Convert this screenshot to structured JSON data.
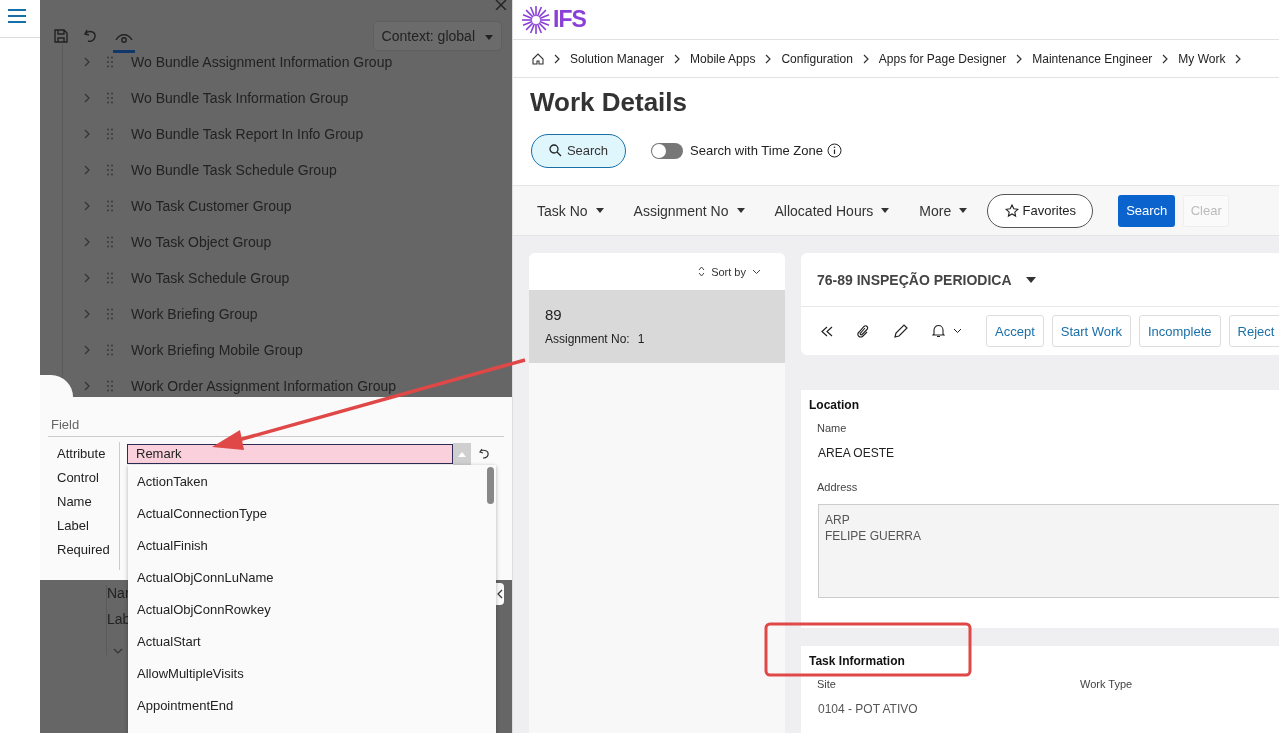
{
  "designer": {
    "context": "Context: global",
    "tree_items": [
      {
        "label": "Wo Bundle Assignment Information Group",
        "expanded": false
      },
      {
        "label": "Wo Bundle Task Information Group",
        "expanded": false
      },
      {
        "label": "Wo Bundle Task Report In Info Group",
        "expanded": false
      },
      {
        "label": "Wo Bundle Task Schedule Group",
        "expanded": false
      },
      {
        "label": "Wo Task Customer Group",
        "expanded": false
      },
      {
        "label": "Wo Task Object Group",
        "expanded": false
      },
      {
        "label": "Wo Task Schedule Group",
        "expanded": false
      },
      {
        "label": "Work Briefing Group",
        "expanded": false
      },
      {
        "label": "Work Briefing Mobile Group",
        "expanded": false
      },
      {
        "label": "Work Order Assignment Information Group",
        "expanded": false
      }
    ],
    "partial_labels": [
      "Nar",
      "Lab"
    ]
  },
  "field_panel": {
    "title": "Field",
    "labels": [
      "Attribute",
      "Control",
      "Name",
      "Label",
      "Required"
    ],
    "attribute": {
      "value": "Remark",
      "invalid": true
    },
    "options": [
      "ActionTaken",
      "ActualConnectionType",
      "ActualFinish",
      "ActualObjConnLuName",
      "ActualObjConnRowkey",
      "ActualStart",
      "AllowMultipleVisits",
      "AppointmentEnd"
    ]
  },
  "app": {
    "logo": "IFS",
    "breadcrumb": [
      "Solution Manager",
      "Mobile Apps",
      "Configuration",
      "Apps for Page Designer",
      "Maintenance Engineer",
      "My Work"
    ],
    "title": "Work Details",
    "search_button": "Search",
    "toggle": {
      "label": "Search with Time Zone",
      "on": false
    },
    "filters": [
      "Task No",
      "Assignment No",
      "Allocated Hours",
      "More"
    ],
    "favorites": "Favorites",
    "search": "Search",
    "clear": {
      "label": "Clear",
      "disabled": true
    }
  },
  "list": {
    "sort": "Sort by",
    "items": [
      {
        "title": "89",
        "label": "Assignment No:",
        "value": "1",
        "selected": true
      }
    ]
  },
  "detail": {
    "title": "76-89 INSPEÇÃO PERIODICA",
    "actions": [
      "Accept",
      "Start Work",
      "Incomplete",
      "Reject"
    ],
    "location": {
      "heading": "Location",
      "name_label": "Name",
      "name": "AREA OESTE",
      "address_label": "Address",
      "address_lines": [
        "ARP",
        "FELIPE GUERRA"
      ]
    },
    "task_info": {
      "heading": "Task Information",
      "fields": [
        {
          "label": "Site",
          "value": "0104 - POT ATIVO"
        },
        {
          "label": "Work Type"
        }
      ]
    }
  }
}
